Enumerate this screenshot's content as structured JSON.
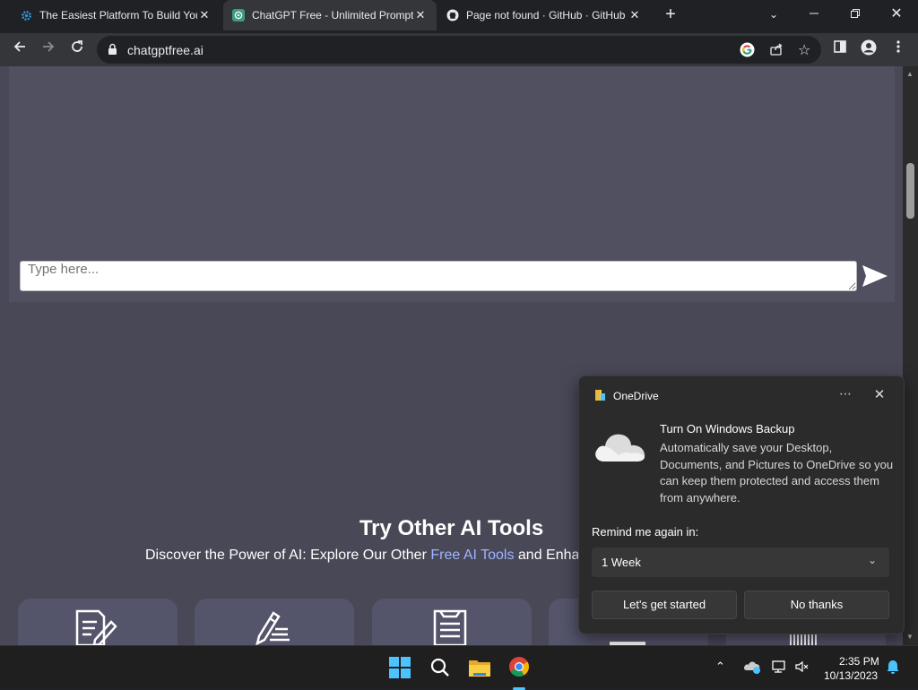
{
  "browser": {
    "tabs": [
      {
        "title": "The Easiest Platform To Build Your Own",
        "icon": "gear-icon",
        "active": false
      },
      {
        "title": "ChatGPT Free - Unlimited Prompts",
        "icon": "chatgpt-icon",
        "active": true
      },
      {
        "title": "Page not found · GitHub · GitHub",
        "icon": "github-icon",
        "active": false
      }
    ],
    "url": "chatgptfree.ai"
  },
  "page": {
    "chat": {
      "placeholder": "Type here..."
    },
    "tools": {
      "title": "Try Other AI Tools",
      "subtitle_before": "Discover the Power of AI: Explore Our Other ",
      "subtitle_link": "Free AI Tools",
      "subtitle_after": " and Enha"
    }
  },
  "onedrive": {
    "app_name": "OneDrive",
    "title": "Turn On Windows Backup",
    "body": "Automatically save your Desktop, Documents, and Pictures to OneDrive so you can keep them protected and access them from anywhere.",
    "remind_label": "Remind me again in:",
    "remind_value": "1 Week",
    "primary_button": "Let's get started",
    "secondary_button": "No thanks"
  },
  "taskbar": {
    "time": "2:35 PM",
    "date": "10/13/2023"
  },
  "colors": {
    "page_bg": "#484857",
    "chat_panel": "#505061",
    "link": "#9fb4ff",
    "accent_blue": "#4cc2ff"
  }
}
